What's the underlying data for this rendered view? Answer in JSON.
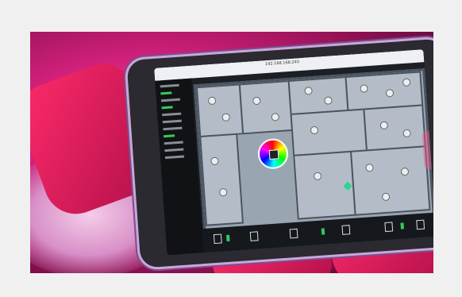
{
  "photo": {
    "subject": "tablet-smart-home-floor-plan",
    "colors": {
      "background": "#f1f0f1",
      "scene_pink": "#d0207a",
      "tablet_frame": "#2a2a30",
      "screen": "#1c1f24",
      "floor_plan": "#9aa5b2"
    }
  },
  "tablet": {
    "url": "192.168.168.240"
  }
}
